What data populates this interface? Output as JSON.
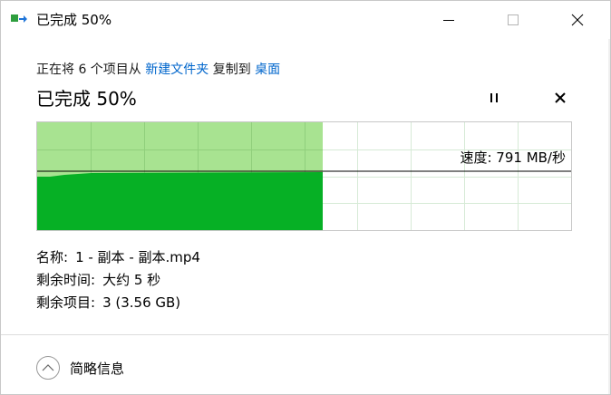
{
  "window": {
    "title": "已完成 50%",
    "controls": {
      "minimize": "minimize-icon",
      "maximize": "maximize-icon",
      "close": "close-icon"
    }
  },
  "header": {
    "prefix": "正在将 6 个项目从 ",
    "source_link": "新建文件夹",
    "middle": " 复制到 ",
    "dest_link": "桌面"
  },
  "status": {
    "text": "已完成 50%",
    "progress": 0.5,
    "pause_icon": "pause-icon",
    "cancel_icon": "cancel-icon"
  },
  "graph": {
    "speed_text": "速度: 791 MB/秒",
    "fill_color": "#06b025",
    "light_color": "#a8e391"
  },
  "details": {
    "name_label": "名称:",
    "name_value": "1 - 副本 - 副本.mp4",
    "time_label": "剩余时间:",
    "time_value": "大约 5 秒",
    "items_label": "剩余项目:",
    "items_value": "3 (3.56 GB)"
  },
  "footer": {
    "toggle_icon": "chevron-up-circle-icon",
    "label": "简略信息"
  }
}
